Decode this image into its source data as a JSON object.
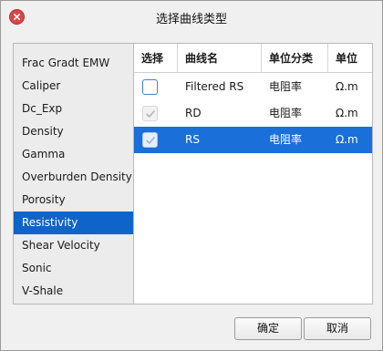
{
  "window": {
    "title": "选择曲线类型"
  },
  "categories": [
    {
      "label": "Frac Gradt EMW",
      "selected": false
    },
    {
      "label": "Caliper",
      "selected": false
    },
    {
      "label": "Dc_Exp",
      "selected": false
    },
    {
      "label": "Density",
      "selected": false
    },
    {
      "label": "Gamma",
      "selected": false
    },
    {
      "label": "Overburden Density",
      "selected": false
    },
    {
      "label": "Porosity",
      "selected": false
    },
    {
      "label": "Resistivity",
      "selected": true
    },
    {
      "label": "Shear Velocity",
      "selected": false
    },
    {
      "label": "Sonic",
      "selected": false
    },
    {
      "label": "V-Shale",
      "selected": false
    }
  ],
  "table": {
    "headers": {
      "select": "选择",
      "name": "曲线名",
      "unit_class": "单位分类",
      "unit": "单位"
    },
    "rows": [
      {
        "checked": false,
        "disabled": false,
        "selected": false,
        "name": "Filtered RS",
        "unit_class": "电阻率",
        "unit": "Ω.m"
      },
      {
        "checked": true,
        "disabled": true,
        "selected": false,
        "name": "RD",
        "unit_class": "电阻率",
        "unit": "Ω.m"
      },
      {
        "checked": true,
        "disabled": true,
        "selected": true,
        "name": "RS",
        "unit_class": "电阻率",
        "unit": "Ω.m"
      }
    ]
  },
  "buttons": {
    "ok": "确定",
    "cancel": "取消"
  },
  "colors": {
    "selection": "#1a6fd8",
    "list_selection": "#0e64c8",
    "close": "#d94848",
    "checkbox_border": "#3b82d8"
  },
  "icons": {
    "close": "close-icon",
    "check": "checkmark-icon"
  }
}
